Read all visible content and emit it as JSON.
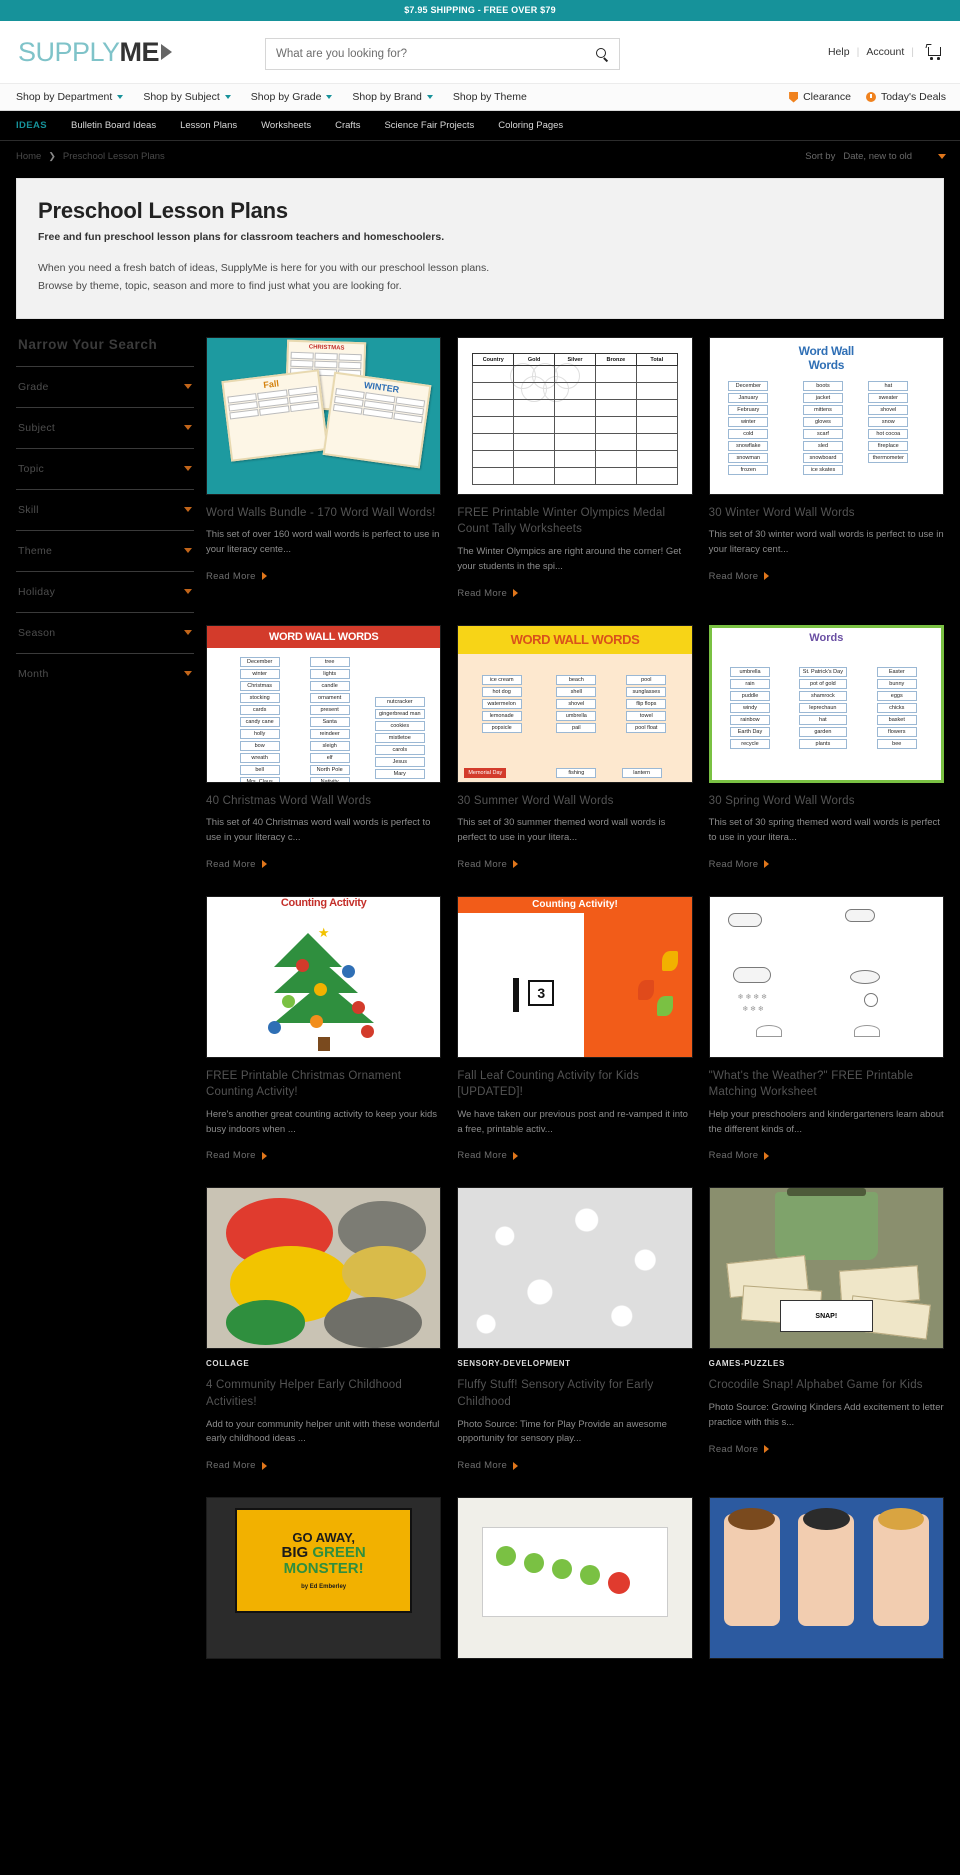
{
  "promo": {
    "text": "$7.95 SHIPPING - FREE OVER $79"
  },
  "header": {
    "logo_supply": "SUPPLY",
    "logo_me": "ME",
    "search_placeholder": "What are you looking for?",
    "search_value": "",
    "help_label": "Help",
    "account_label": "Account",
    "separator": "|"
  },
  "main_nav": {
    "items": [
      {
        "label": "Shop by Department",
        "caret": true
      },
      {
        "label": "Shop by Subject",
        "caret": true
      },
      {
        "label": "Shop by Grade",
        "caret": true
      },
      {
        "label": "Shop by Brand",
        "caret": true
      },
      {
        "label": "Shop by Theme",
        "caret": false
      }
    ],
    "right": [
      {
        "label": "Clearance",
        "icon": "tag-icon"
      },
      {
        "label": "Today's Deals",
        "icon": "clock-icon"
      }
    ]
  },
  "ideas_nav": {
    "label": "IDEAS",
    "items": [
      "Bulletin Board Ideas",
      "Lesson Plans",
      "Worksheets",
      "Crafts",
      "Science Fair Projects",
      "Coloring Pages"
    ]
  },
  "breadcrumb": {
    "home": "Home",
    "arrow": "❯",
    "current": "Preschool Lesson Plans"
  },
  "sort": {
    "label": "Sort by",
    "value": "Date, new to old"
  },
  "hero": {
    "title": "Preschool Lesson Plans",
    "subtitle": "Free and fun preschool lesson plans for classroom teachers and homeschoolers.",
    "paragraph1": "When you need a fresh batch of ideas, SupplyMe is here for you with our preschool lesson plans.",
    "paragraph2": "Browse by theme, topic, season and more to find just what you are looking for."
  },
  "sidebar": {
    "title": "Narrow Your Search",
    "filters": [
      {
        "label": "Grade"
      },
      {
        "label": "Subject"
      },
      {
        "label": "Topic"
      },
      {
        "label": "Skill"
      },
      {
        "label": "Theme"
      },
      {
        "label": "Holiday"
      },
      {
        "label": "Season"
      },
      {
        "label": "Month"
      }
    ]
  },
  "read_more_label": "Read More",
  "cards": [
    {
      "category": "",
      "title": "Word Walls Bundle - 170 Word Wall Words!",
      "desc": "This set of over 160 word wall words is perfect to use in your literacy cente...",
      "art": "bundle"
    },
    {
      "category": "",
      "title": "FREE Printable Winter Olympics Medal Count Tally Worksheets",
      "desc": "The Winter Olympics are right around the corner! Get your students in the spi...",
      "art": "tally"
    },
    {
      "category": "",
      "title": "30 Winter Word Wall Words",
      "desc": "This set of 30 winter word wall words is perfect to use in your literacy cent...",
      "art": "winterwords"
    },
    {
      "category": "",
      "title": "40 Christmas Word Wall Words",
      "desc": "This set of 40 Christmas word wall words is perfect to use in your literacy c...",
      "art": "redbanner"
    },
    {
      "category": "",
      "title": "30 Summer Word Wall Words",
      "desc": "This set of 30 summer themed word wall words is perfect to use in your litera...",
      "art": "yellow"
    },
    {
      "category": "",
      "title": "30 Spring Word Wall Words",
      "desc": "This set of 30 spring themed word wall words is perfect to use in your litera...",
      "art": "spring"
    },
    {
      "category": "",
      "title": "FREE Printable Christmas Ornament Counting Activity!",
      "desc": "Here's another great counting activity to keep your kids busy indoors when ...",
      "art": "xmastree"
    },
    {
      "category": "",
      "title": "Fall Leaf Counting Activity for Kids [UPDATED]!",
      "desc": "We have taken our previous post and re-vamped it into a free, printable activ...",
      "art": "fallleaf"
    },
    {
      "category": "",
      "title": "\"What's the Weather?\" FREE Printable Matching Worksheet",
      "desc": "Help your preschoolers and kindergarteners learn about the different kinds of...",
      "art": "weather"
    },
    {
      "category": "COLLAGE",
      "title": "4 Community Helper Early Childhood Activities!",
      "desc": "Add to your community helper unit with these wonderful early childhood ideas ...",
      "art": "dough"
    },
    {
      "category": "SENSORY-DEVELOPMENT",
      "title": "Fluffy Stuff! Sensory Activity for Early Childhood",
      "desc": "Photo Source: Time for Play Provide an awesome opportunity for sensory play...",
      "art": "fluffy"
    },
    {
      "category": "GAMES-PUZZLES",
      "title": "Crocodile Snap! Alphabet Game for Kids",
      "desc": "Photo Source: Growing Kinders Add excitement to letter practice with this s...",
      "art": "croc"
    },
    {
      "category": "",
      "title": "",
      "desc": "",
      "art": "monster"
    },
    {
      "category": "",
      "title": "",
      "desc": "",
      "art": "caterpillar"
    },
    {
      "category": "",
      "title": "",
      "desc": "",
      "art": "people"
    }
  ],
  "colors": {
    "promo_bg": "#16929a",
    "accent_teal": "#16929a",
    "accent_orange": "#e0761b",
    "page_bg": "#000000",
    "hero_bg": "#f2f2f2"
  }
}
